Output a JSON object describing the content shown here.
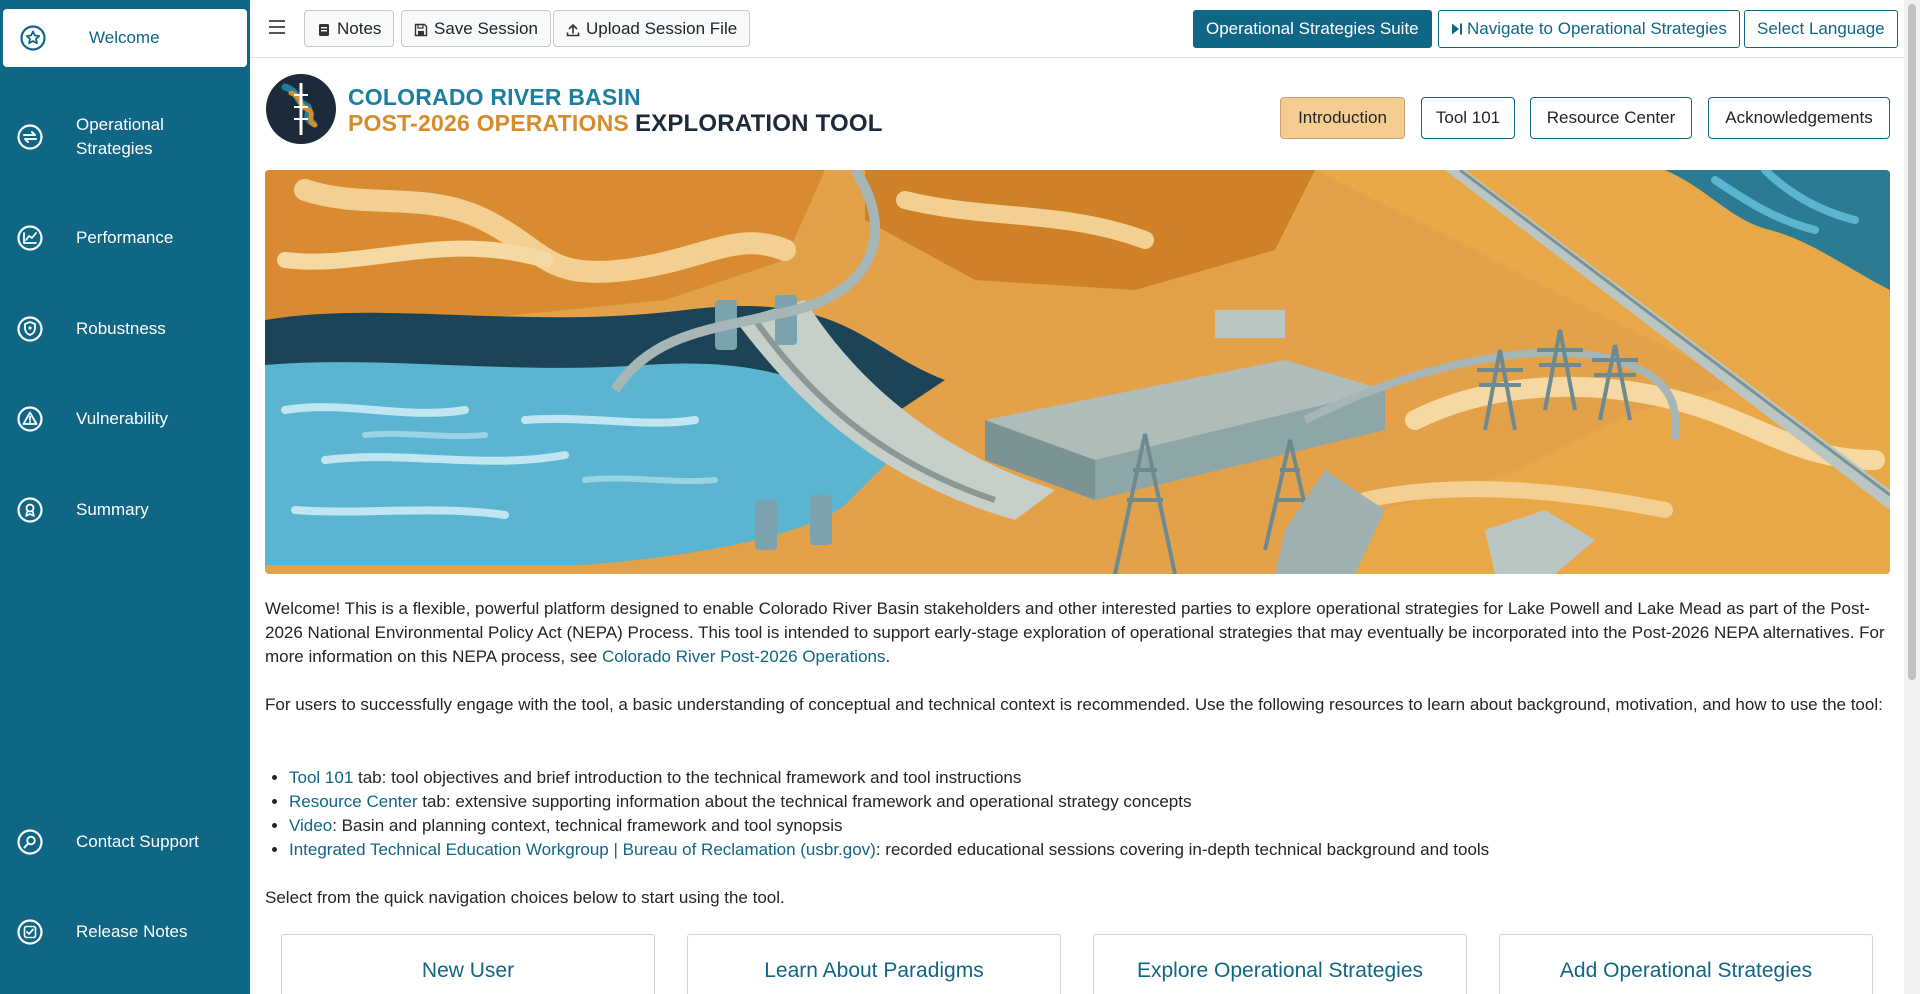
{
  "sidebar": {
    "items": [
      {
        "label": "Welcome",
        "icon": "star-circle-icon"
      },
      {
        "label": "Operational\nStrategies",
        "icon": "swap-circle-icon"
      },
      {
        "label": "Performance",
        "icon": "chart-circle-icon"
      },
      {
        "label": "Robustness",
        "icon": "shield-circle-icon"
      },
      {
        "label": "Vulnerability",
        "icon": "warning-circle-icon"
      },
      {
        "label": "Summary",
        "icon": "award-circle-icon"
      },
      {
        "label": "Contact Support",
        "icon": "search-circle-icon"
      },
      {
        "label": "Release Notes",
        "icon": "check-circle-icon"
      }
    ]
  },
  "toolbar": {
    "notes": "Notes",
    "save_session": "Save Session",
    "upload_session": "Upload Session File",
    "suite": "Operational Strategies Suite",
    "navigate": "Navigate to Operational Strategies",
    "language": "Select Language"
  },
  "header": {
    "logo_line1": "COLORADO RIVER BASIN",
    "logo_line2_orange": "POST-2026 OPERATIONS",
    "logo_line2_dark": "EXPLORATION TOOL",
    "tabs": [
      "Introduction",
      "Tool 101",
      "Resource Center",
      "Acknowledgements"
    ]
  },
  "intro": {
    "p1_text": "Welcome! This is a flexible, powerful platform designed to enable Colorado River Basin stakeholders and other interested parties to explore operational strategies for Lake Powell and Lake Mead as part of the Post-2026 National Environmental Policy Act (NEPA) Process. This tool is intended to support early-stage exploration of operational strategies that may eventually be incorporated into the Post-2026 NEPA alternatives. For more information on this NEPA process, see ",
    "p1_link": "Colorado River Post-2026 Operations",
    "p1_end": ".",
    "p2": "For users to successfully engage with the tool, a basic understanding of conceptual and technical context is recommended. Use the following resources to learn about background, motivation, and how to use the tool:",
    "bullets": [
      {
        "link": "Tool 101",
        "text": " tab: tool objectives and brief introduction to the technical framework and tool instructions"
      },
      {
        "link": "Resource Center",
        "text": " tab: extensive supporting information about the technical framework and operational strategy concepts"
      },
      {
        "link": "Video",
        "text": ": Basin and planning context, technical framework and tool synopsis"
      },
      {
        "link": "Integrated Technical Education Workgroup | Bureau of Reclamation (usbr.gov)",
        "text": ": recorded educational sessions covering in-depth technical background and tools"
      }
    ],
    "p3": "Select from the quick navigation choices below to start using the tool."
  },
  "quick_nav": [
    "New User",
    "Learn About Paradigms",
    "Explore Operational Strategies",
    "Add Operational Strategies"
  ],
  "colors": {
    "primary": "#0f6685",
    "active_tab": "#f6cd90",
    "logo_orange": "#d48c2c"
  }
}
